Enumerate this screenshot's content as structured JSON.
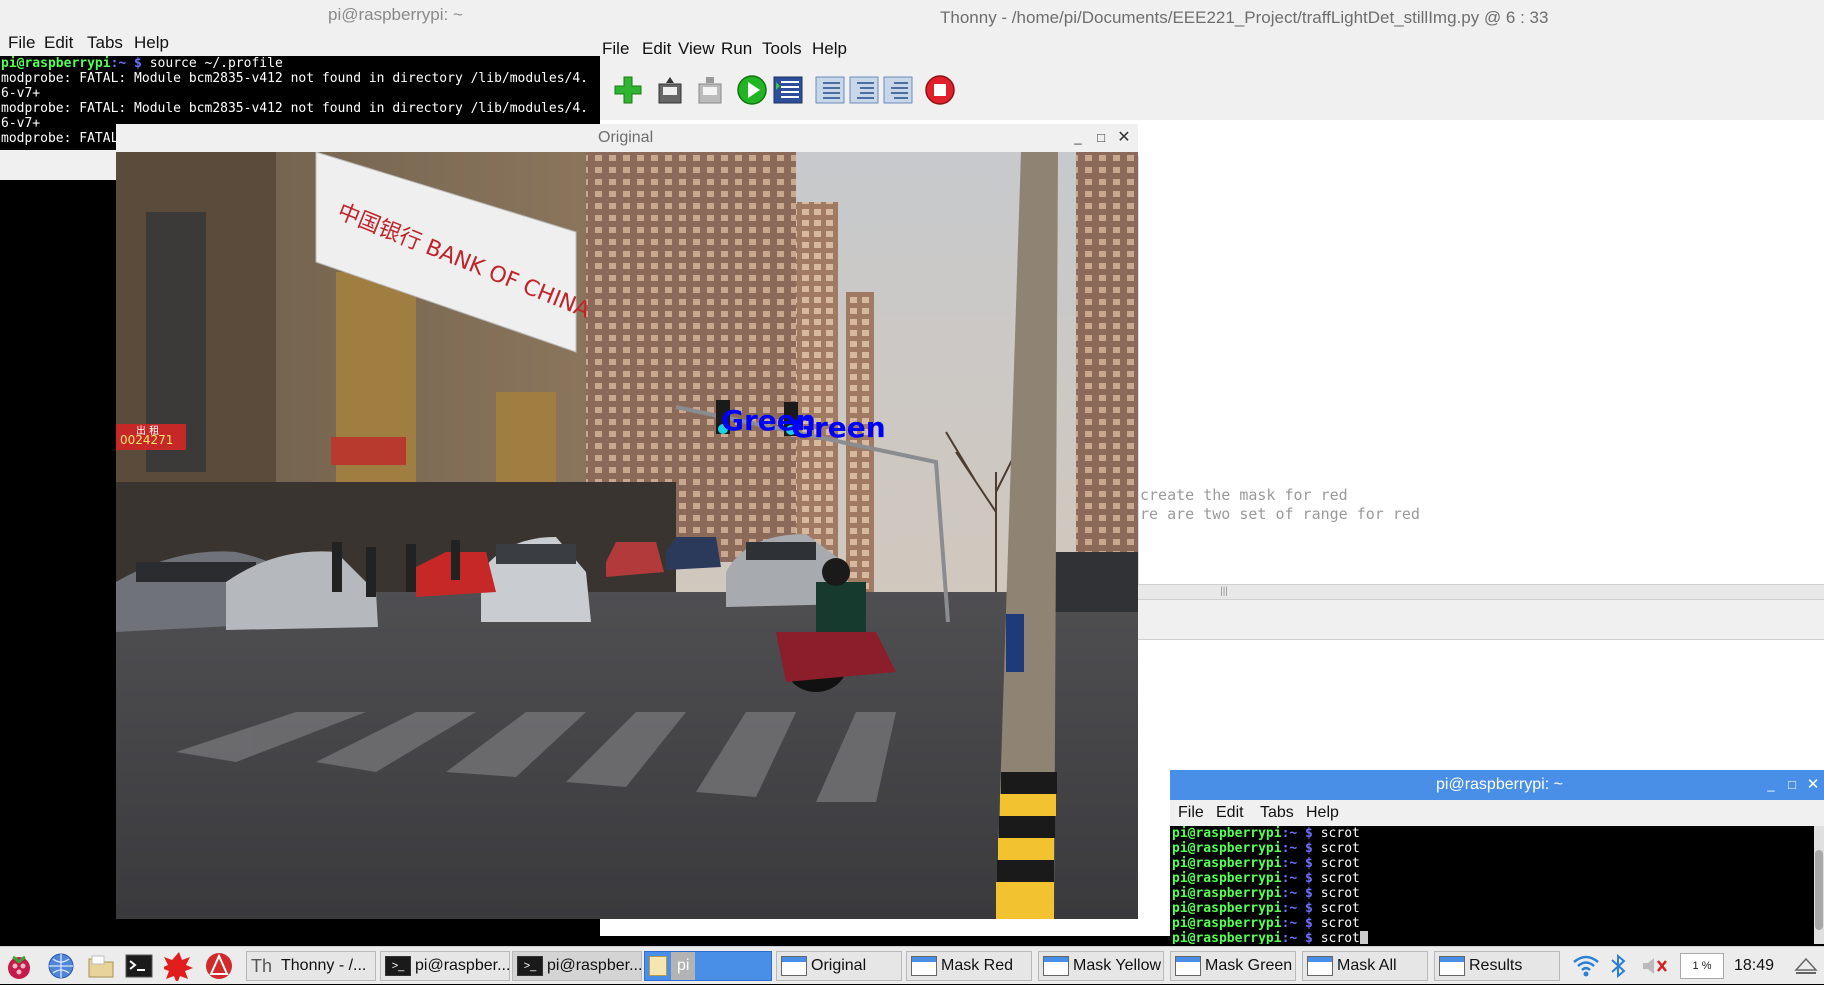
{
  "thonny": {
    "title": "Thonny  -  /home/pi/Documents/EEE221_Project/traffLightDet_stillImg.py  @  6 : 33",
    "menu": [
      "File",
      "Edit",
      "View",
      "Run",
      "Tools",
      "Help"
    ],
    "toolbar_icons": [
      "new-file-icon",
      "open-file-icon",
      "save-file-icon",
      "run-icon",
      "debug-icon",
      "step-over-icon",
      "step-into-icon",
      "step-out-icon",
      "stop-icon"
    ],
    "editor_lines": [
      "create the mask for red",
      "re are two set of range for red"
    ]
  },
  "terminal_top": {
    "title": "pi@raspberrypi: ~",
    "menu": [
      "File",
      "Edit",
      "Tabs",
      "Help"
    ],
    "lines": [
      {
        "user": "pi@raspberrypi",
        "path": ":~ $",
        "cmd": " source ~/.profile"
      },
      {
        "text": "modprobe: FATAL: Module bcm2835-v412 not found in directory /lib/modules/4."
      },
      {
        "text": "6-v7+"
      },
      {
        "text": "modprobe: FATAL: Module bcm2835-v412 not found in directory /lib/modules/4."
      },
      {
        "text": "6-v7+"
      },
      {
        "text": "modprobe: FATAL"
      }
    ]
  },
  "original_window": {
    "title": "Original",
    "detections": [
      {
        "label": "Green",
        "color": "#0000ff"
      },
      {
        "label": "Green",
        "color": "#0000ff"
      }
    ],
    "photo_signs": {
      "bank": "中国银行 BANK OF CHINA",
      "sign_red": "出 租",
      "sign_number": "0024271"
    }
  },
  "terminal_bottom": {
    "title": "pi@raspberrypi: ~",
    "menu": [
      "File",
      "Edit",
      "Tabs",
      "Help"
    ],
    "prompt_user": "pi@raspberrypi",
    "prompt_path": ":~ $",
    "commands": [
      "scrot",
      "scrot",
      "scrot",
      "scrot",
      "scrot",
      "scrot",
      "scrot",
      "scrot"
    ]
  },
  "taskbar": {
    "launchers": [
      "raspberry-menu-icon",
      "web-browser-icon",
      "file-manager-icon",
      "terminal-icon",
      "math-icon",
      "wolfram-icon"
    ],
    "tasks": [
      {
        "label": "Thonny  -  /...",
        "kind": "thonny"
      },
      {
        "label": "pi@raspber...",
        "kind": "term"
      },
      {
        "label": "pi@raspber...",
        "kind": "term"
      },
      {
        "label": "pi",
        "kind": "folder"
      },
      {
        "label": "Original",
        "kind": "window"
      },
      {
        "label": "Mask Red",
        "kind": "window"
      },
      {
        "label": "Mask Yellow",
        "kind": "window"
      },
      {
        "label": "Mask Green",
        "kind": "window"
      },
      {
        "label": "Mask All",
        "kind": "window"
      },
      {
        "label": "Results",
        "kind": "window"
      }
    ],
    "cpu": "1 %",
    "clock": "18:49",
    "accent": "#4a8fe7"
  }
}
